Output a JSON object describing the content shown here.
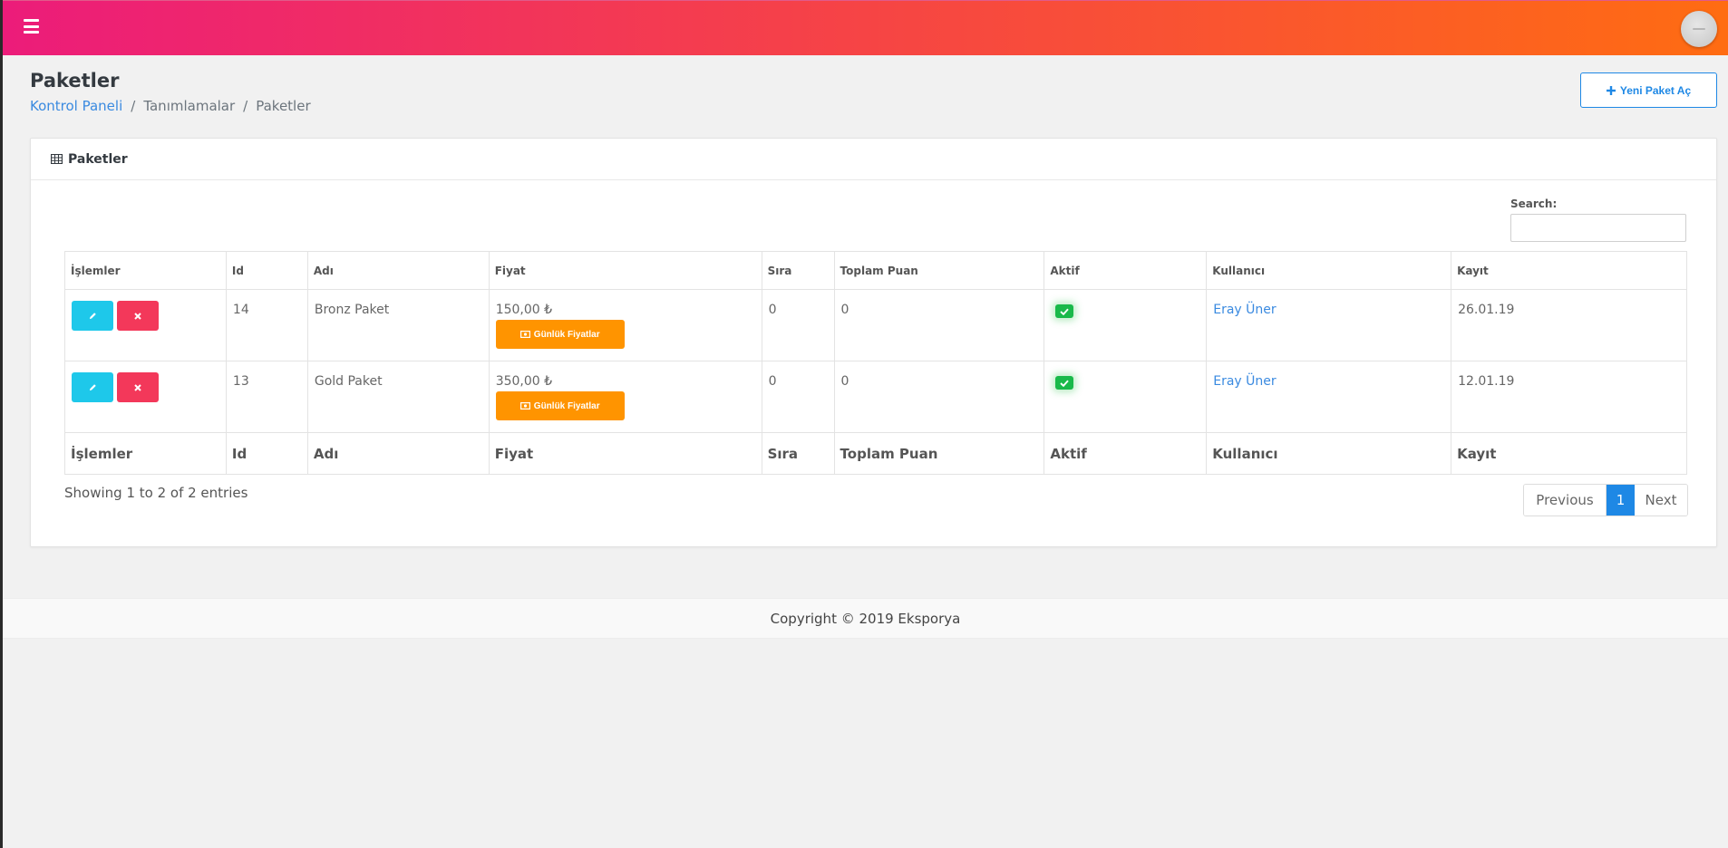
{
  "header": {
    "menu_icon": "hamburger-icon",
    "avatar_icon": "user-avatar"
  },
  "page": {
    "title": "Paketler",
    "breadcrumb": [
      "Kontrol Paneli",
      "Tanımlamalar",
      "Paketler"
    ],
    "separator": "/",
    "new_button_label": "Yeni Paket Aç",
    "new_button_icon": "plus-icon"
  },
  "card": {
    "title": "Paketler",
    "title_icon": "table-icon",
    "search_label": "Search:",
    "search_value": "",
    "columns": [
      "İşlemler",
      "Id",
      "Adı",
      "Fiyat",
      "Sıra",
      "Toplam Puan",
      "Aktif",
      "Kullanıcı",
      "Kayıt"
    ],
    "rows": [
      {
        "id": "14",
        "name": "Bronz Paket",
        "price": "150,00 ₺",
        "daily_label": "Günlük Fiyatlar",
        "order": "0",
        "total_points": "0",
        "active": true,
        "user": "Eray Üner",
        "date": "26.01.19"
      },
      {
        "id": "13",
        "name": "Gold Paket",
        "price": "350,00 ₺",
        "daily_label": "Günlük Fiyatlar",
        "order": "0",
        "total_points": "0",
        "active": true,
        "user": "Eray Üner",
        "date": "12.01.19"
      }
    ],
    "entries_info": "Showing 1 to 2 of 2 entries",
    "pagination": {
      "previous": "Previous",
      "current": "1",
      "next": "Next"
    }
  },
  "footer": {
    "text": "Copyright © 2019 Eksporya"
  },
  "colors": {
    "gradient_start": "#ec1c7a",
    "gradient_end": "#ff6c12",
    "primary": "#1e88e5",
    "edit": "#1ec8ea",
    "delete": "#f3385a",
    "warning": "#ff9400",
    "success": "#19b94a"
  }
}
